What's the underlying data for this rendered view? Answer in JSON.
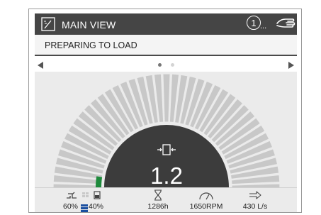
{
  "header": {
    "title": "MAIN VIEW",
    "badge_number": "1",
    "badge_more": "...",
    "icons": [
      "main-view-icon",
      "alert-number-icon",
      "manual-control-icon"
    ]
  },
  "status": {
    "text": "PREPARING TO LOAD"
  },
  "pager": {
    "current": 1,
    "total": 2
  },
  "gauge": {
    "value": "1.2",
    "icon": "load-position-icon",
    "green_fill_fraction": 0.05,
    "colors": {
      "ray": "#c8c8c8",
      "center": "#3c3c3c",
      "active": "#1e8a3c",
      "background": "#ebebeb"
    }
  },
  "footer": {
    "fuel_percent": "60%",
    "def_percent": "40%",
    "hours": "1286h",
    "rpm": "1650RPM",
    "flow": "430 L/s",
    "icons": [
      "fuel-pump-icon",
      "fuel-tank-icon",
      "hourglass-icon",
      "tachometer-icon",
      "flow-arrow-icon"
    ],
    "colors": {
      "def_bar": "#1a4fa0"
    }
  }
}
